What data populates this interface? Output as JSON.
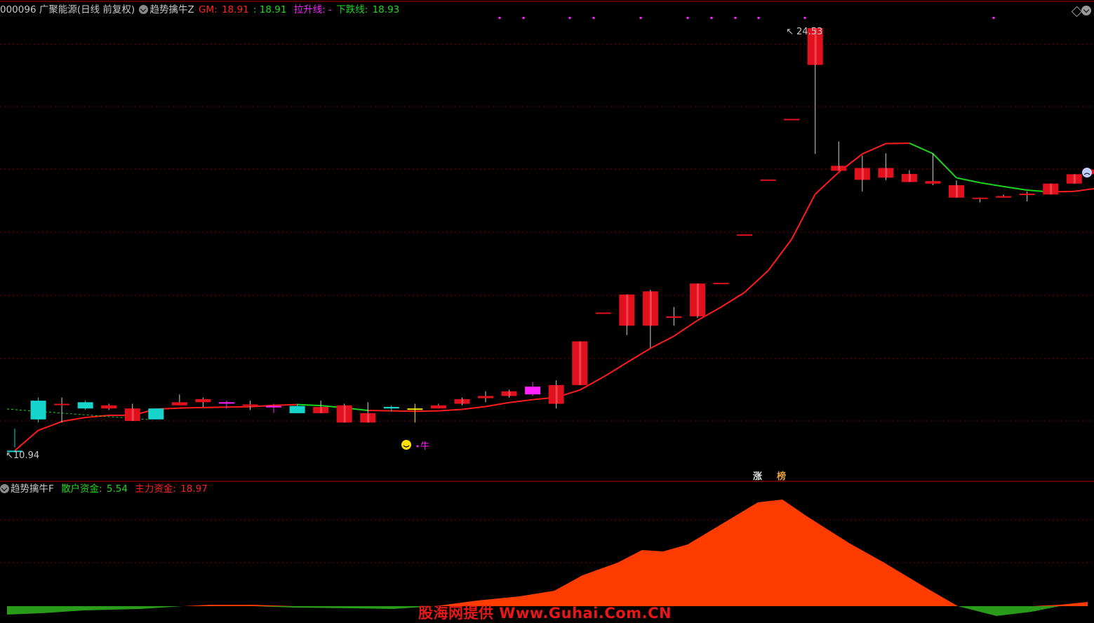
{
  "main_panel": {
    "stock_label": "000096 广聚能源(日线 前复权)",
    "indicator_name": "趋势擒牛Z",
    "gm_label": "GM:",
    "gm_value1": "18.91",
    "gm_value2": ": 18.91",
    "up_line_label": "拉升线: -",
    "down_line_label": "下跌线:",
    "down_line_value": "18.93",
    "high_marker": "24.53",
    "low_marker": "10.94",
    "bull_tag": "牛",
    "badge_1": "涨",
    "badge_2": "榜"
  },
  "sub_panel": {
    "indicator_name": "趋势擒牛F",
    "retail_label": "散户资金:",
    "retail_value": "5.54",
    "main_label": "主力资金:",
    "main_value": "18.97"
  },
  "watermark": "股海网提供 Www.Guhai.Com.CN",
  "colors": {
    "background": "#000000",
    "grid": "#7a0000",
    "up_candle": "#e0101c",
    "down_candle": "#17d4cc",
    "highlight_candle": "#ff22ff",
    "yellow_candle": "#ffee00",
    "trend_up": "#ff1c1c",
    "trend_down": "#1cd41c",
    "fund_positive": "#ff3c00",
    "fund_negative": "#2a9a1a"
  },
  "chart_data": {
    "type": "candlestick",
    "price_high": 24.53,
    "price_low": 10.94,
    "candles": [
      {
        "o": 11.0,
        "h": 11.7,
        "l": 11.1,
        "c": 11.0,
        "k": "down"
      },
      {
        "o": 12.6,
        "h": 12.7,
        "l": 11.9,
        "c": 12.0,
        "k": "down"
      },
      {
        "o": 12.5,
        "h": 12.7,
        "l": 11.9,
        "c": 12.5,
        "k": "up"
      },
      {
        "o": 12.55,
        "h": 12.6,
        "l": 12.3,
        "c": 12.35,
        "k": "down"
      },
      {
        "o": 12.45,
        "h": 12.5,
        "l": 12.3,
        "c": 12.35,
        "k": "up"
      },
      {
        "o": 12.35,
        "h": 12.5,
        "l": 11.95,
        "c": 11.95,
        "k": "up"
      },
      {
        "o": 12.35,
        "h": 12.35,
        "l": 12.0,
        "c": 12.0,
        "k": "down"
      },
      {
        "o": 12.55,
        "h": 12.8,
        "l": 12.45,
        "c": 12.45,
        "k": "up"
      },
      {
        "o": 12.65,
        "h": 12.7,
        "l": 12.4,
        "c": 12.55,
        "k": "up"
      },
      {
        "o": 12.55,
        "h": 12.6,
        "l": 12.35,
        "c": 12.55,
        "k": "pink"
      },
      {
        "o": 12.48,
        "h": 12.6,
        "l": 12.3,
        "c": 12.43,
        "k": "up"
      },
      {
        "o": 12.43,
        "h": 12.5,
        "l": 12.2,
        "c": 12.43,
        "k": "pink"
      },
      {
        "o": 12.43,
        "h": 12.5,
        "l": 12.2,
        "c": 12.2,
        "k": "down"
      },
      {
        "o": 12.2,
        "h": 12.6,
        "l": 12.2,
        "c": 12.4,
        "k": "up"
      },
      {
        "o": 12.45,
        "h": 12.5,
        "l": 11.9,
        "c": 11.9,
        "k": "up"
      },
      {
        "o": 12.2,
        "h": 12.55,
        "l": 11.9,
        "c": 11.9,
        "k": "up"
      },
      {
        "o": 12.35,
        "h": 12.45,
        "l": 12.25,
        "c": 12.4,
        "k": "down"
      },
      {
        "o": 12.35,
        "h": 12.5,
        "l": 11.9,
        "c": 12.35,
        "k": "yellow"
      },
      {
        "o": 12.35,
        "h": 12.5,
        "l": 12.35,
        "c": 12.45,
        "k": "up"
      },
      {
        "o": 12.5,
        "h": 12.7,
        "l": 12.45,
        "c": 12.65,
        "k": "up"
      },
      {
        "o": 12.68,
        "h": 12.9,
        "l": 12.55,
        "c": 12.75,
        "k": "up"
      },
      {
        "o": 12.75,
        "h": 12.95,
        "l": 12.7,
        "c": 12.9,
        "k": "up"
      },
      {
        "o": 12.8,
        "h": 13.2,
        "l": 12.75,
        "c": 13.05,
        "k": "pink"
      },
      {
        "o": 12.5,
        "h": 13.25,
        "l": 12.35,
        "c": 13.1,
        "k": "up"
      },
      {
        "o": 13.1,
        "h": 14.5,
        "l": 13.1,
        "c": 14.5,
        "k": "up"
      },
      {
        "o": 14.75,
        "h": 15.3,
        "l": 15.3,
        "c": 15.4,
        "k": "flat"
      },
      {
        "o": 15.0,
        "h": 16.0,
        "l": 14.7,
        "c": 16.0,
        "k": "up"
      },
      {
        "o": 15.0,
        "h": 16.15,
        "l": 14.3,
        "c": 16.1,
        "k": "up"
      },
      {
        "o": 15.25,
        "h": 15.6,
        "l": 15.0,
        "c": 15.3,
        "k": "up"
      },
      {
        "o": 15.3,
        "h": 16.35,
        "l": 15.25,
        "c": 16.35,
        "k": "up"
      },
      {
        "o": 16.35,
        "h": 16.35,
        "l": 16.35,
        "c": 16.35,
        "k": "flat"
      },
      {
        "o": 17.9,
        "h": 17.9,
        "l": 17.9,
        "c": 17.9,
        "k": "flat"
      },
      {
        "o": 19.66,
        "h": 19.66,
        "l": 19.66,
        "c": 19.66,
        "k": "flat"
      },
      {
        "o": 21.6,
        "h": 21.6,
        "l": 21.6,
        "c": 21.6,
        "k": "flat"
      },
      {
        "o": 23.35,
        "h": 24.53,
        "l": 20.5,
        "c": 24.53,
        "k": "up"
      },
      {
        "o": 19.96,
        "h": 20.9,
        "l": 19.96,
        "c": 20.12,
        "k": "up"
      },
      {
        "o": 19.67,
        "h": 20.45,
        "l": 19.3,
        "c": 20.05,
        "k": "up"
      },
      {
        "o": 19.74,
        "h": 20.52,
        "l": 19.66,
        "c": 20.05,
        "k": "up"
      },
      {
        "o": 19.6,
        "h": 19.98,
        "l": 19.6,
        "c": 19.86,
        "k": "up"
      },
      {
        "o": 19.55,
        "h": 20.52,
        "l": 19.5,
        "c": 19.63,
        "k": "up"
      },
      {
        "o": 19.1,
        "h": 19.65,
        "l": 19.1,
        "c": 19.5,
        "k": "up"
      },
      {
        "o": 19.1,
        "h": 19.1,
        "l": 18.95,
        "c": 19.1,
        "k": "up"
      },
      {
        "o": 19.1,
        "h": 19.2,
        "l": 19.1,
        "c": 19.15,
        "k": "up"
      },
      {
        "o": 19.18,
        "h": 19.3,
        "l": 18.98,
        "c": 19.23,
        "k": "up"
      },
      {
        "o": 19.2,
        "h": 19.55,
        "l": 19.2,
        "c": 19.55,
        "k": "up"
      },
      {
        "o": 19.55,
        "h": 19.85,
        "l": 19.55,
        "c": 19.85,
        "k": "up"
      },
      {
        "o": 19.85,
        "h": 20.0,
        "l": 19.7,
        "c": 20.0,
        "k": "up"
      },
      {
        "o": 20.0,
        "h": 20.1,
        "l": 19.85,
        "c": 20.1,
        "k": "up"
      }
    ]
  }
}
